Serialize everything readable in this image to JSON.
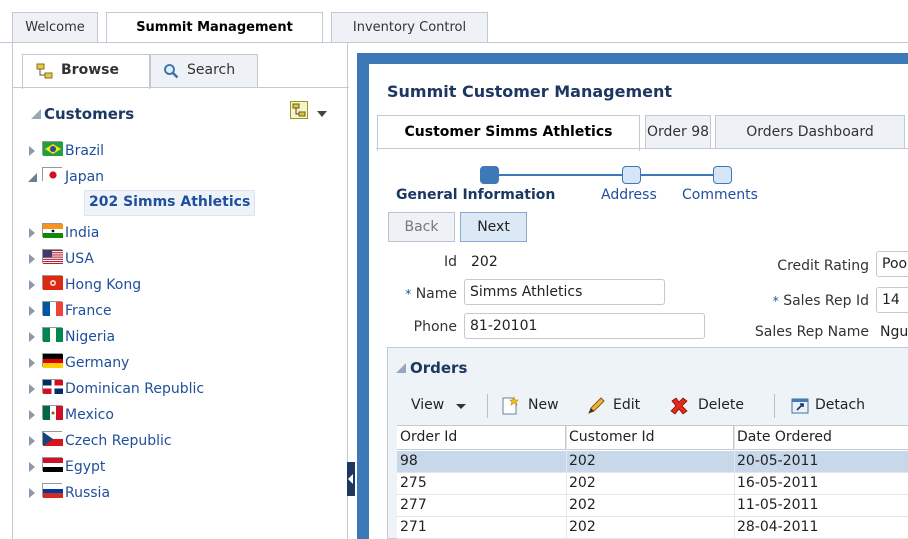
{
  "top_tabs": [
    {
      "label": "Welcome",
      "active": false
    },
    {
      "label": "Summit Management",
      "active": true
    },
    {
      "label": "Inventory Control",
      "active": false
    }
  ],
  "left": {
    "tabs": [
      {
        "label": "Browse",
        "icon": "hierarchy-icon",
        "active": true
      },
      {
        "label": "Search",
        "icon": "search-icon",
        "active": false
      }
    ],
    "heading": "Customers",
    "tree": [
      {
        "label": "Brazil",
        "expanded": false,
        "flag": "brazil"
      },
      {
        "label": "Japan",
        "expanded": true,
        "flag": "japan"
      },
      {
        "label": "India",
        "expanded": false,
        "flag": "india"
      },
      {
        "label": "USA",
        "expanded": false,
        "flag": "usa"
      },
      {
        "label": "Hong Kong",
        "expanded": false,
        "flag": "hongkong"
      },
      {
        "label": "France",
        "expanded": false,
        "flag": "france"
      },
      {
        "label": "Nigeria",
        "expanded": false,
        "flag": "nigeria"
      },
      {
        "label": "Germany",
        "expanded": false,
        "flag": "germany"
      },
      {
        "label": "Dominican Republic",
        "expanded": false,
        "flag": "dominican"
      },
      {
        "label": "Mexico",
        "expanded": false,
        "flag": "mexico"
      },
      {
        "label": "Czech Republic",
        "expanded": false,
        "flag": "czech"
      },
      {
        "label": "Egypt",
        "expanded": false,
        "flag": "egypt"
      },
      {
        "label": "Russia",
        "expanded": false,
        "flag": "russia"
      }
    ],
    "selected_child": "202 Simms Athletics"
  },
  "main": {
    "title": "Summit Customer Management",
    "tabs": [
      {
        "label": "Customer Simms Athletics",
        "active": true
      },
      {
        "label": "Order 98",
        "active": false
      },
      {
        "label": "Orders Dashboard",
        "active": false
      }
    ],
    "train": [
      {
        "label": "General Information",
        "current": true
      },
      {
        "label": "Address",
        "current": false
      },
      {
        "label": "Comments",
        "current": false
      }
    ],
    "buttons": {
      "back": "Back",
      "next": "Next"
    },
    "form": {
      "id_label": "Id",
      "id_value": "202",
      "name_label": "Name",
      "name_value": "Simms Athletics",
      "phone_label": "Phone",
      "phone_value": "81-20101",
      "credit_label": "Credit Rating",
      "credit_value": "Poo",
      "salesrep_id_label": "Sales Rep Id",
      "salesrep_id_value": "14",
      "salesrep_name_label": "Sales Rep Name",
      "salesrep_name_value": "Ngu",
      "required_mark": "*"
    },
    "orders": {
      "heading": "Orders",
      "toolbar": {
        "view": "View",
        "new": "New",
        "edit": "Edit",
        "delete": "Delete",
        "detach": "Detach"
      },
      "columns": [
        "Order Id",
        "Customer Id",
        "Date Ordered"
      ],
      "rows": [
        [
          "98",
          "202",
          "20-05-2011"
        ],
        [
          "275",
          "202",
          "16-05-2011"
        ],
        [
          "277",
          "202",
          "11-05-2011"
        ],
        [
          "271",
          "202",
          "28-04-2011"
        ]
      ],
      "selected_row": 0
    }
  },
  "colors": {
    "frame_blue": "#3d78b7",
    "title_navy": "#1c3760",
    "link_blue": "#1f4f9c",
    "selection": "#c7d8ea"
  }
}
